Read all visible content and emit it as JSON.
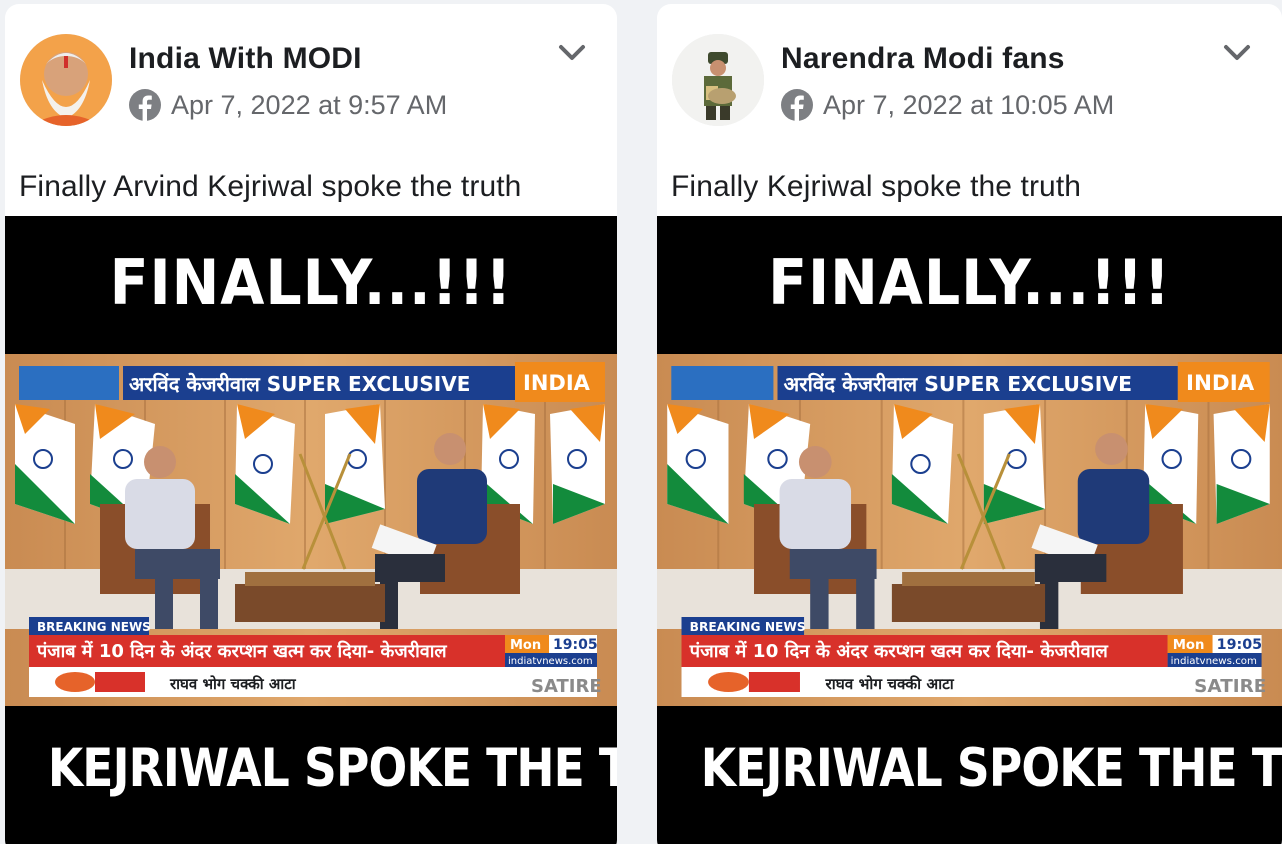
{
  "posts": [
    {
      "author": "India With MODI",
      "timestamp": "Apr 7, 2022 at 9:57 AM",
      "text": "Finally Arvind Kejriwal spoke the truth",
      "media": {
        "headline_top": "FINALLY...!!!",
        "banner_title": "अरविंद केजरीवाल SUPER EXCLUSIVE",
        "channel_logo": "INDIA",
        "breaking_label": "BREAKING NEWS",
        "ticker": "पंजाब में 10 दिन के अंदर करप्शन खत्म कर दिया- केजरीवाल",
        "day": "Mon",
        "time": "19:05",
        "site": "indiatvnews.com",
        "sponsor": "राघव भोग चक्की आटा",
        "satire": "SATIRE",
        "headline_bottom": "KEJRIWAL SPOKE THE TRUTH"
      }
    },
    {
      "author": "Narendra Modi fans",
      "timestamp": "Apr 7, 2022 at 10:05 AM",
      "text": "Finally Kejriwal spoke the truth",
      "media": {
        "headline_top": "FINALLY...!!!",
        "banner_title": "अरविंद केजरीवाल SUPER EXCLUSIVE",
        "channel_logo": "INDIA",
        "breaking_label": "BREAKING NEWS",
        "ticker": "पंजाब में 10 दिन के अंदर करप्शन खत्म कर दिया- केजरीवाल",
        "day": "Mon",
        "time": "19:05",
        "site": "indiatvnews.com",
        "sponsor": "राघव भोग चक्की आटा",
        "satire": "SATIRE",
        "headline_bottom": "KEJRIWAL SPOKE THE TRUTH"
      }
    }
  ],
  "icons": {
    "platform": "facebook-icon",
    "menu": "chevron-down-icon"
  },
  "colors": {
    "page_bg": "#f0f2f5",
    "card_bg": "#ffffff",
    "text_primary": "#1c1e21",
    "text_secondary": "#65676b",
    "ticker_red": "#d8312a",
    "banner_blue": "#1b3f8f"
  }
}
